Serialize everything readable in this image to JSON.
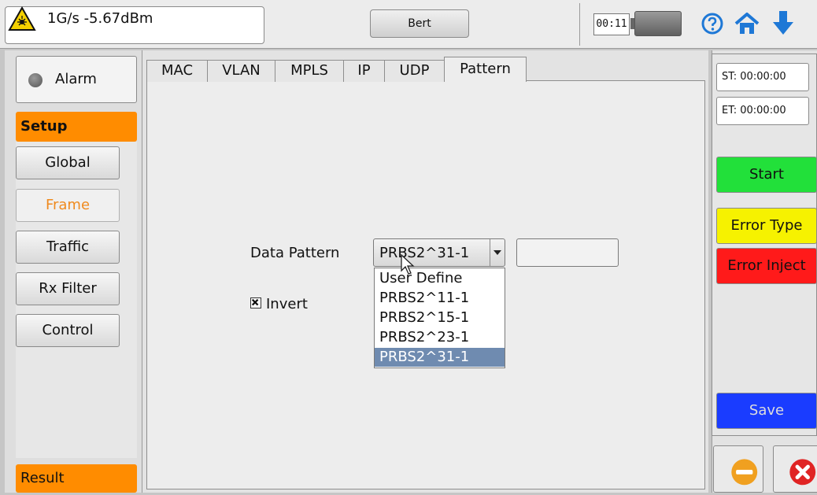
{
  "status": {
    "signal_text": "1G/s -5.67dBm",
    "mode_button": "Bert",
    "clock": "00:11"
  },
  "left": {
    "alarm_label": "Alarm",
    "setup_label": "Setup",
    "nav": [
      "Global",
      "Frame",
      "Traffic",
      "Rx Filter",
      "Control"
    ],
    "active_nav": "Frame",
    "result_label": "Result"
  },
  "tabs": [
    "MAC",
    "VLAN",
    "MPLS",
    "IP",
    "UDP",
    "Pattern"
  ],
  "active_tab": "Pattern",
  "pattern": {
    "data_pattern_label": "Data Pattern",
    "selected": "PRBS2^31-1",
    "options": [
      "User Define",
      "PRBS2^11-1",
      "PRBS2^15-1",
      "PRBS2^23-1",
      "PRBS2^31-1"
    ],
    "invert_label": "Invert",
    "invert_checked": true,
    "user_value": ""
  },
  "right": {
    "st": "ST:  00:00:00",
    "et": "ET:  00:00:00",
    "start": "Start",
    "error_type": "Error Type",
    "error_inject": "Error Inject",
    "save": "Save"
  },
  "colors": {
    "accent_orange": "#ff8c00",
    "start_green": "#22e03a",
    "error_type_yellow": "#f6f200",
    "error_inject_red": "#ff1a1a",
    "save_blue": "#1a3cff",
    "selected_option": "#6f8bb0"
  }
}
